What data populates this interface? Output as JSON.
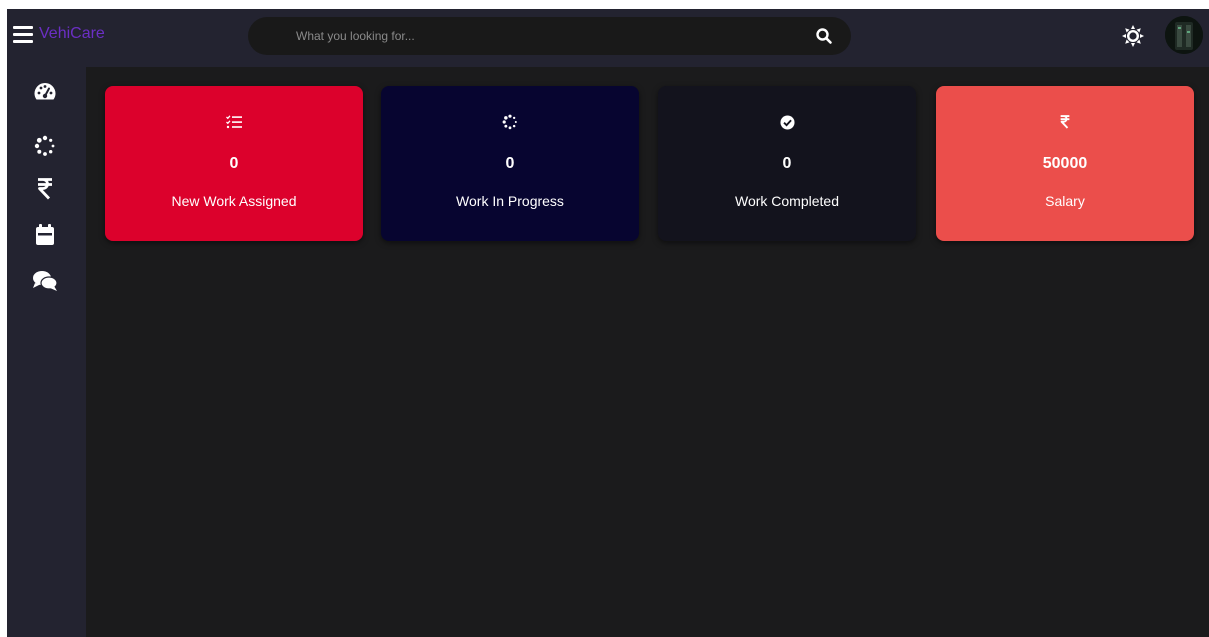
{
  "header": {
    "brand": "VehiCare",
    "search_placeholder": "What you looking for...",
    "search_value": ""
  },
  "sidebar": {
    "items": [
      {
        "id": "dashboard",
        "icon": "tachometer-icon"
      },
      {
        "id": "progress",
        "icon": "spinner-icon"
      },
      {
        "id": "salary",
        "icon": "rupee-icon"
      },
      {
        "id": "calendar",
        "icon": "calendar-icon"
      },
      {
        "id": "messages",
        "icon": "comments-icon"
      }
    ]
  },
  "cards": [
    {
      "label": "New Work Assigned",
      "value": "0",
      "icon": "tasks-icon",
      "color": "#dc012c"
    },
    {
      "label": "Work In Progress",
      "value": "0",
      "icon": "spinner-icon",
      "color": "#070530"
    },
    {
      "label": "Work Completed",
      "value": "0",
      "icon": "check-circle-icon",
      "color": "#13131d"
    },
    {
      "label": "Salary",
      "value": "50000",
      "icon": "rupee-icon",
      "color": "#eb4e4b"
    }
  ],
  "theme": {
    "accent": "#6b2fc4",
    "bar_bg": "#232330",
    "content_bg": "#1b1b1c"
  }
}
